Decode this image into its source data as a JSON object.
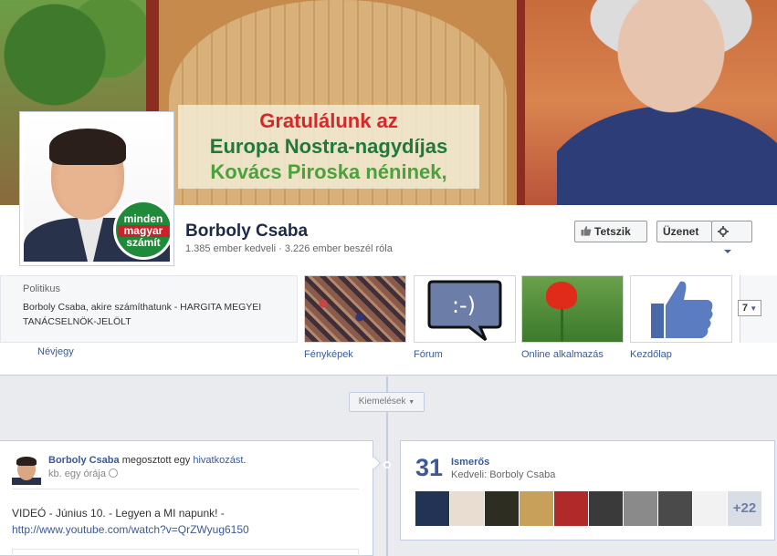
{
  "cover": {
    "line1": "Gratulálunk az",
    "line2": "Europa Nostra-nagydíjas",
    "line3": "Kovács Piroska néninek,"
  },
  "badge": {
    "top": "minden",
    "mid": "magyar",
    "bottom": "számít"
  },
  "profile": {
    "name": "Borboly Csaba",
    "stats": "1.385 ember kedveli · 3.226 ember beszél róla",
    "category": "Politikus",
    "description": "Borboly Csaba, akire számíthatunk - HARGITA MEGYEI TANÁCSELNÖK-JELÖLT",
    "about_link": "Névjegy"
  },
  "actions": {
    "like": "Tetszik",
    "message": "Üzenet"
  },
  "tiles": [
    {
      "label": "Fényképek"
    },
    {
      "label": "Fórum",
      "icon_text": ":-)"
    },
    {
      "label": "Online alkalmazás"
    },
    {
      "label": "Kezdőlap"
    }
  ],
  "tiles_more": "7",
  "timeline": {
    "highlights": "Kiemelések"
  },
  "post": {
    "author": "Borboly Csaba",
    "shared": "megosztott egy",
    "link_word": "hivatkozást",
    "period": ".",
    "time": "kb. egy órája",
    "text": "VIDEÓ - Június 10. - Legyen a MI napunk! -",
    "url": "http://www.youtube.com/watch?v=QrZWyug6150"
  },
  "friends": {
    "count": "31",
    "title": "Ismerős",
    "subtitle": "Kedveli: Borboly Csaba",
    "more": "+22",
    "photo_colors": [
      "#223355",
      "#e8ddd0",
      "#2d2d22",
      "#c9a05a",
      "#b02a2a",
      "#3a3a3a",
      "#8a8a8a",
      "#4a4a4a",
      "#f2f2f2"
    ]
  },
  "colors": {
    "brand_blue": "#3b5998",
    "name_color": "#1c2a47"
  }
}
